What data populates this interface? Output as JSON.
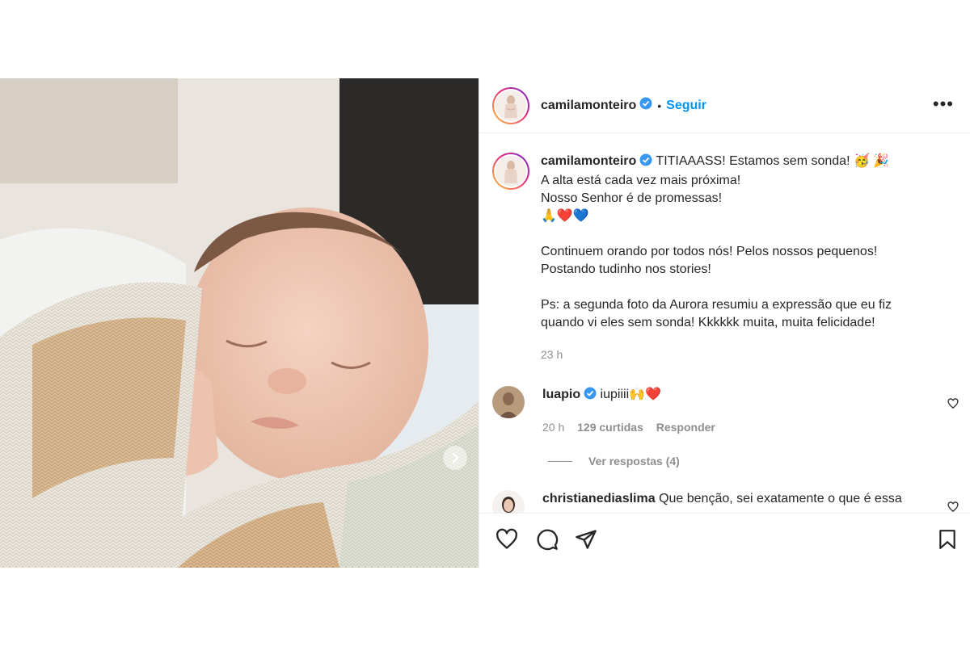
{
  "post": {
    "author": {
      "username": "camilamonteiro",
      "verified": true,
      "follow_label": "Seguir"
    },
    "more_label": "•••",
    "caption": {
      "username": "camilamonteiro",
      "text": " TITIAAASS! Estamos sem sonda! 🥳 🎉\nA alta está cada vez mais próxima!\nNosso Senhor é de promessas!\n🙏❤️💙\n\nContinuem orando por todos nós! Pelos nossos pequenos!\nPostando tudinho nos stories!\n\nPs: a segunda foto da Aurora resumiu a expressão que eu fiz quando vi eles sem sonda! Kkkkkk muita, muita felicidade!",
      "time": "23 h"
    },
    "comments": [
      {
        "username": "luapio",
        "verified": true,
        "text": " iupiiii🙌❤️",
        "time": "20 h",
        "likes": "129 curtidas",
        "reply_label": "Responder",
        "view_replies": "Ver respostas (4)"
      },
      {
        "username": "christianediaslima",
        "verified": false,
        "text": " Que benção, sei exatamente o que é essa"
      }
    ]
  },
  "colors": {
    "accent": "#0095f6",
    "text": "#262626",
    "muted": "#8e8e8e",
    "verified": "#3897f0",
    "border": "#efefef"
  },
  "icons": [
    "verified-badge-icon",
    "more-options-icon",
    "chevron-right-icon",
    "heart-icon",
    "comment-icon",
    "share-icon",
    "bookmark-icon"
  ]
}
